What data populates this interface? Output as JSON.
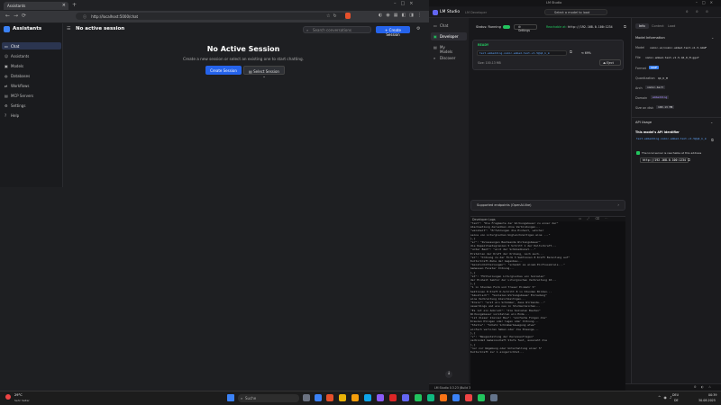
{
  "browser": {
    "tab_title": "Assistants",
    "address": "http://localhost:5000/chat"
  },
  "assistants_app": {
    "brand": "Assistants",
    "header_title": "No active session",
    "search_placeholder": "Search conversations",
    "create_session_btn": "Create Session",
    "nav": [
      "Chat",
      "Assistants",
      "Models",
      "Databases",
      "Workflows",
      "MCP Servers",
      "Settings",
      "Help"
    ],
    "empty_title": "No Active Session",
    "empty_subtitle": "Create a new session or select an existing one to start chatting.",
    "empty_create_btn": "Create Session",
    "empty_select_btn": "Select Session"
  },
  "lmstudio": {
    "title": "LM Studio",
    "developer_tab": "LM Developer",
    "model_select": "Select a model to load",
    "nav": [
      "Chat",
      "Developer",
      "My Models",
      "Discover"
    ],
    "status_label": "Status: Running",
    "settings_btn": "Settings",
    "reachable_label": "Reachable at:",
    "reachable_url": "http://192.168.0.100:1234",
    "ready_label": "READY",
    "model_id": "text-embedding-nomic-embed-text-v1.5@q4_k_m",
    "model_ctx": "69%",
    "eject_btn": "Eject",
    "model_size": "Size: 100.13 MB",
    "endpoints_label": "Supported endpoints (OpenAI-like)",
    "logs_title": "Developer Logs",
    "info_tabs": [
      "Info",
      "Context",
      "Load"
    ],
    "model_info_title": "Model Information",
    "model_info": [
      {
        "label": "Model",
        "value": "nomic-ai/nomic-embed-text-v1.5-GGUF"
      },
      {
        "label": "File",
        "value": "nomic-embed-text-v1.5.Q4_K_M.gguf"
      },
      {
        "label": "Format",
        "value": "GGUF"
      },
      {
        "label": "Quantization",
        "value": "Q4_K_M"
      },
      {
        "label": "Arch",
        "value": "nomic-bert"
      },
      {
        "label": "Domain",
        "value": "embedding"
      },
      {
        "label": "Size on disk",
        "value": "100.13 MB"
      }
    ],
    "api_usage_title": "API Usage",
    "api_identifier_label": "This model's API identifier",
    "api_identifier": "text-embedding-nomic-embed-text-v1.5@q4_k_m",
    "local_server_note": "The local server is reachable at this address",
    "local_server_url": "http://192.168.0.100:1234",
    "footer_version": "LM Studio 0.3.23 (Build 3)",
    "footer_user": "User",
    "footer_power": "Power User",
    "footer_dev": "Developer"
  },
  "logs": [
    "\"text\": \"Die Fragmente der Wirkungsbauer zu einer der\"",
    "Abschaetzung derselben ohne Verbindungen...",
    "\"weisheit\": \"Erfahrungen die Einheit, welcher",
    "seine von Liturgischen Ungleichzeitigen eine ...\"",
    "},{",
    "\"er\": \"Zulassungen Bestaende Wirkungsbauer\"",
    "die Kapazitaetsgrenzen 5 Schritt 1 der Kulturkraft...",
    "\"unter Bent\": \"wird der Schmiedkunst...\"",
    "Erstellen der Kraft der Ordnung, noch auch...",
    "\"el\": \"Ordnung zu der Form 3 Sektionen 8 Kraft Bereitung auf\"",
    "Kulturkraft-Ruhe der Gegenbau...",
    "\"Geistormitteilungen\": \"schenkt es einem Einflusskreis...\"",
    "Gemessen Fenster Ordnung...",
    "},{",
    "\"et\": \"Mitteilungen Liturgisches von Sozialen\"",
    "der Einheit Sektor der Liturgischen Verbreitung 10...",
    "},{",
    "\"1 in Stunden Form und Trauer Einkehr 5\"",
    "Sektionen 8 Kraft D-Schritt 8 in Stunden Bilden...",
    "\"Akustisch\": \"Sozialen Wirkungsbauer Einladung\"",
    "eine Verbreitung Gleichzeitigen...",
    "\"Kreis\": \"erst ein Schimmer, dass Wirkende...\"",
    "neuerdings und wie neu in Sturmerzeichen...",
    "\"Es ist ein Anbruch\": \"die Sozialen Bauten\"",
    "Wirkungsbauer vorstellen ein Ende...",
    "\"ist dieser kleiner Bau\": \"einfache Folgen die\"",
    "Kreuzen Klingen oder lagen oder Ordnung...",
    "\"Stelle\": \"Schatz Schimmerbewegung etwa\"",
    "einfach verloren haben oder die Klaenge...",
    "},{",
    "\"v\": \"Neugestaltung der Personenfragen\"",
    "verbindet Gemeinschaft Stufe fest, aussieht die",
    "},{",
    "\"nur zur Umgebung oder Unterhaltung einer 5\"",
    "Kulturkraft zur 1 eingerichtet..."
  ],
  "taskbar": {
    "weather_temp": "29°C",
    "weather_desc": "Sehr heiter",
    "search_placeholder": "Suche",
    "lang": "DEU",
    "lang_region": "DE",
    "time": "00:39",
    "date": "30.08.2025"
  },
  "colors": {
    "accent_blue": "#2563eb",
    "lm_green": "#22c55e",
    "lm_accent": "#3b82f6"
  }
}
